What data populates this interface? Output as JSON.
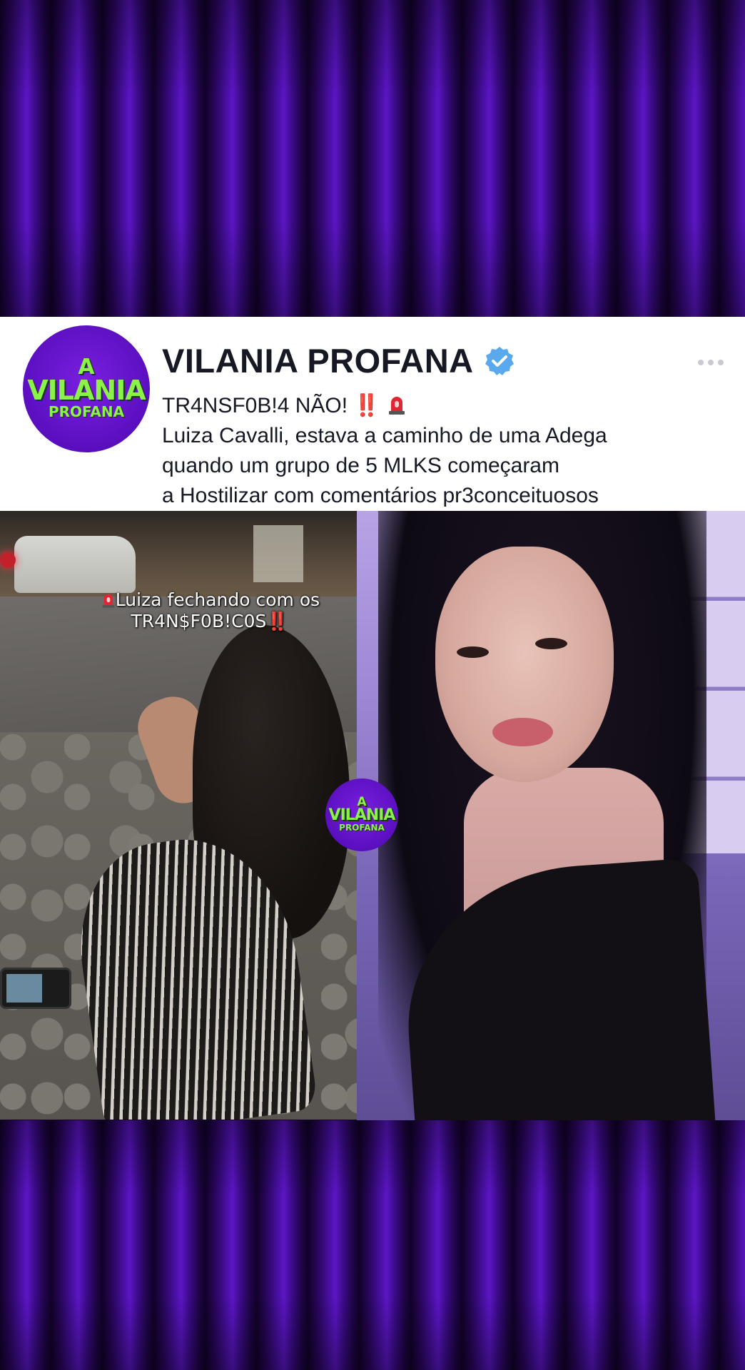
{
  "background": {
    "curtain_color": "#4a10a6",
    "curtain_shadow": "#12022a"
  },
  "post": {
    "avatar": {
      "logo_top": "A",
      "logo_main": "VILANIA",
      "logo_sub": "PROFANA"
    },
    "account_name": "VILANIA PROFANA",
    "verified_icon": "verified-badge-icon",
    "more_icon": "more-options-icon",
    "caption": {
      "headline": "TR4NSF0B!4 NÃO!",
      "headline_marks": "‼️",
      "line2": "Luiza Cavalli, estava a caminho de uma Adega",
      "line3": "quando um grupo de 5 MLKS começaram",
      "line4": "a Hostilizar com comentários pr3conceituosos"
    }
  },
  "media": {
    "left_overlay": {
      "line1": "Luiza fechando com os",
      "line2": "TR4N$F0B!C0S"
    },
    "watermark": {
      "logo_top": "A",
      "logo_main": "VILANIA",
      "logo_sub": "PROFANA"
    }
  }
}
